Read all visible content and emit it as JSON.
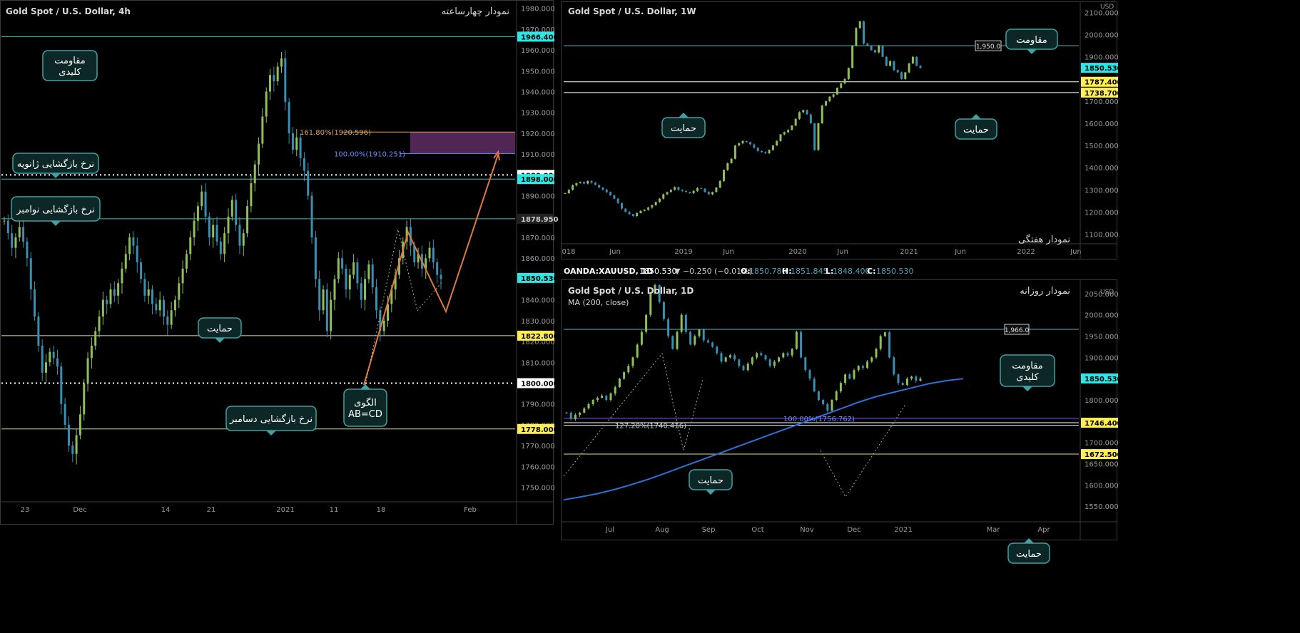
{
  "chart_data": [
    {
      "panel": "left",
      "type": "line",
      "title": "Gold Spot / U.S. Dollar, 4h",
      "subtitle": "نمودار چهارساعته",
      "x_ticks": [
        "23",
        "Dec",
        "14",
        "21",
        "2021",
        "11",
        "18",
        "Feb"
      ],
      "y_ticks": [
        "1750.000",
        "1760.000",
        "1770.000",
        "1780.000",
        "1790.000",
        "1800.000",
        "1810.000",
        "1820.000",
        "1830.000",
        "1840.000",
        "1850.000",
        "1860.000",
        "1870.000",
        "1880.000",
        "1890.000",
        "1900.000",
        "1910.000",
        "1920.000",
        "1930.000",
        "1940.000",
        "1950.000",
        "1960.000",
        "1970.000",
        "1980.000"
      ],
      "ylim": [
        1743,
        1984
      ],
      "price": [
        1878,
        1872,
        1865,
        1870,
        1875,
        1868,
        1860,
        1845,
        1832,
        1818,
        1805,
        1810,
        1815,
        1812,
        1808,
        1790,
        1780,
        1770,
        1766,
        1775,
        1785,
        1800,
        1812,
        1818,
        1825,
        1832,
        1840,
        1838,
        1845,
        1842,
        1848,
        1855,
        1862,
        1870,
        1866,
        1858,
        1850,
        1842,
        1845,
        1838,
        1835,
        1840,
        1832,
        1828,
        1835,
        1840,
        1848,
        1855,
        1862,
        1870,
        1878,
        1885,
        1892,
        1880,
        1870,
        1876,
        1868,
        1862,
        1872,
        1880,
        1888,
        1876,
        1866,
        1872,
        1885,
        1896,
        1905,
        1915,
        1928,
        1940,
        1948,
        1945,
        1952,
        1956,
        1935,
        1920,
        1912,
        1918,
        1908,
        1902,
        1890,
        1870,
        1850,
        1835,
        1845,
        1825,
        1840,
        1850,
        1860,
        1855,
        1845,
        1852,
        1858,
        1848,
        1840,
        1850,
        1857,
        1846,
        1835,
        1825,
        1830,
        1838,
        1845,
        1852,
        1860,
        1868,
        1875,
        1866,
        1858,
        1862,
        1855,
        1860,
        1865,
        1858,
        1852,
        1850
      ],
      "horizontal_levels": [
        {
          "value": 1966.4,
          "label": "1966.400",
          "line_color": "#4fb8c4",
          "box_color": "#2ee6e6",
          "text_color": "#000000"
        },
        {
          "value": 1900.0,
          "label": "1900.000",
          "line_color": "#ffffff",
          "dotted": true,
          "box_color": "#ffffff",
          "text_color": "#000000"
        },
        {
          "value": 1898.0,
          "label": "1898.000",
          "line_color": "#4fb8c4",
          "box_color": "#2ee6e6",
          "text_color": "#000000"
        },
        {
          "value": 1878.95,
          "label": "1878.950",
          "line_color": "#4fb8c4",
          "box_color": "#222222",
          "text_color": "#cccccc"
        },
        {
          "value": 1850.53,
          "label": "1850.530",
          "line_color": null,
          "box_color": "#2ee6e6",
          "text_color": "#000000"
        },
        {
          "value": 1822.8,
          "label": "1822.800",
          "line_color": "#dede9a",
          "box_color": "#ffee58",
          "text_color": "#000000"
        },
        {
          "value": 1800.0,
          "label": "1800.000",
          "line_color": "#ffffff",
          "dotted": true,
          "box_color": "#ffffff",
          "text_color": "#000000"
        },
        {
          "value": 1778.0,
          "label": "1778.000",
          "line_color": "#dede9a",
          "box_color": "#ffee58",
          "text_color": "#000000"
        }
      ],
      "fibonacci": [
        {
          "label": "161.80%(1920.596)",
          "value": 1920.596,
          "color": "#e0a060"
        },
        {
          "label": "100.00%(1910.251)",
          "value": 1910.251,
          "color": "#6c8cff"
        }
      ],
      "annotations": [
        {
          "id": "key-resistance",
          "text": [
            "مقاومت",
            "کلیدی"
          ]
        },
        {
          "id": "jan-open",
          "text": [
            "نرخ بازگشایی ژانویه"
          ]
        },
        {
          "id": "nov-open",
          "text": [
            "نرخ بازگشایی نوامبر"
          ]
        },
        {
          "id": "support",
          "text": [
            "حمایت"
          ]
        },
        {
          "id": "dec-open",
          "text": [
            "نرخ بازگشایی دسامبر"
          ]
        },
        {
          "id": "abcd",
          "text": [
            "الگوی",
            "AB=CD"
          ]
        }
      ]
    },
    {
      "panel": "top-right",
      "type": "line",
      "title": "Gold Spot / U.S. Dollar, 1W",
      "subtitle": "نمودار هفتگی",
      "currency_label": "USD",
      "x_ticks": [
        "018",
        "Jun",
        "2019",
        "Jun",
        "2020",
        "Jun",
        "2021",
        "Jun",
        "2022",
        "Jun"
      ],
      "y_ticks": [
        "1100.000",
        "1200.000",
        "1300.000",
        "1400.000",
        "1500.000",
        "1600.000",
        "1700.000",
        "1800.000",
        "1900.000",
        "2000.000",
        "2100.000"
      ],
      "ylim": [
        1050,
        2150
      ],
      "price": [
        1285,
        1300,
        1320,
        1330,
        1335,
        1328,
        1340,
        1332,
        1322,
        1310,
        1300,
        1290,
        1275,
        1260,
        1240,
        1215,
        1200,
        1190,
        1182,
        1195,
        1205,
        1210,
        1220,
        1230,
        1245,
        1260,
        1280,
        1290,
        1300,
        1312,
        1300,
        1295,
        1290,
        1285,
        1295,
        1308,
        1305,
        1290,
        1280,
        1290,
        1310,
        1340,
        1390,
        1420,
        1440,
        1500,
        1510,
        1520,
        1515,
        1505,
        1490,
        1475,
        1470,
        1465,
        1480,
        1500,
        1520,
        1550,
        1560,
        1570,
        1590,
        1620,
        1650,
        1660,
        1640,
        1600,
        1480,
        1600,
        1680,
        1700,
        1720,
        1730,
        1760,
        1780,
        1800,
        1850,
        1950,
        2030,
        2060,
        1960,
        1950,
        1930,
        1920,
        1950,
        1900,
        1860,
        1880,
        1840,
        1830,
        1800,
        1830,
        1870,
        1900,
        1860,
        1850
      ],
      "horizontal_levels": [
        {
          "value": 1950.0,
          "label": "1,950.0",
          "line_color": "#4fb8c4"
        },
        {
          "value": 1850.53,
          "label": "1850.530",
          "line_color": null,
          "box_color": "#2ee6e6",
          "text_color": "#000000"
        },
        {
          "value": 1787.4,
          "label": "1787.400",
          "line_color": "#ffffff",
          "box_color": "#ffee58",
          "text_color": "#000000"
        },
        {
          "value": 1738.7,
          "label": "1738.700",
          "line_color": "#ffffff",
          "box_color": "#ffee58",
          "text_color": "#000000"
        }
      ],
      "annotations": [
        {
          "id": "resistance",
          "text": [
            "مقاومت"
          ]
        },
        {
          "id": "support-left",
          "text": [
            "حمایت"
          ]
        },
        {
          "id": "support-right",
          "text": [
            "حمایت"
          ]
        }
      ]
    },
    {
      "panel": "bottom-right",
      "type": "line",
      "title": "Gold Spot / U.S. Dollar, 1D",
      "subtitle": "نمودار روزانه",
      "indicator_label": "MA (200, close)",
      "currency_label": "USD",
      "x_ticks": [
        "Jul",
        "Aug",
        "Sep",
        "Oct",
        "Nov",
        "Dec",
        "2021",
        "Mar",
        "Apr"
      ],
      "y_ticks": [
        "1550.000",
        "1600.000",
        "1650.000",
        "1700.000",
        "1750.000",
        "1800.000",
        "1850.000",
        "1900.000",
        "1950.000",
        "2000.000",
        "2050.000"
      ],
      "ylim": [
        1515,
        2080
      ],
      "price": [
        1770,
        1755,
        1765,
        1770,
        1780,
        1790,
        1800,
        1805,
        1810,
        1800,
        1815,
        1830,
        1850,
        1865,
        1880,
        1900,
        1930,
        1960,
        2000,
        2050,
        2070,
        2030,
        1990,
        1950,
        1920,
        1960,
        2000,
        1960,
        1930,
        1950,
        1965,
        1940,
        1935,
        1925,
        1910,
        1890,
        1900,
        1905,
        1895,
        1880,
        1870,
        1885,
        1900,
        1910,
        1905,
        1895,
        1880,
        1890,
        1900,
        1910,
        1905,
        1920,
        1960,
        1900,
        1870,
        1850,
        1820,
        1800,
        1790,
        1775,
        1800,
        1820,
        1840,
        1860,
        1850,
        1870,
        1880,
        1875,
        1890,
        1900,
        1920,
        1950,
        1959,
        1900,
        1860,
        1840,
        1835,
        1850,
        1855,
        1845,
        1850
      ],
      "ma200": [
        1565,
        1572,
        1580,
        1590,
        1602,
        1615,
        1630,
        1645,
        1660,
        1675,
        1690,
        1705,
        1720,
        1735,
        1750,
        1765,
        1780,
        1795,
        1808,
        1818,
        1828,
        1838,
        1845,
        1850
      ],
      "horizontal_levels": [
        {
          "value": 1966.0,
          "label": "1,966.0",
          "line_color": "#4fb8c4"
        },
        {
          "value": 1850.53,
          "label": "1850.530",
          "line_color": null,
          "box_color": "#2ee6e6",
          "text_color": "#000000"
        },
        {
          "value": 1756.762,
          "label": "",
          "line_color": "#8a55ff"
        },
        {
          "value": 1746.4,
          "label": "1746.400",
          "line_color": "#ffffff",
          "box_color": "#ffee58",
          "text_color": "#000000"
        },
        {
          "value": 1740.416,
          "label": "",
          "line_color": "#dddddd"
        },
        {
          "value": 1672.5,
          "label": "1672.500",
          "line_color": "#dede9a",
          "box_color": "#ffee58",
          "text_color": "#000000"
        }
      ],
      "fibonacci": [
        {
          "label": "100.00%(1756.762)",
          "value": 1756.762,
          "color": "#6c8cff"
        },
        {
          "label": "127.20%(1740.416)",
          "value": 1740.416,
          "color": "#cccccc"
        }
      ],
      "annotations": [
        {
          "id": "key-resistance",
          "text": [
            "مقاومت",
            "کلیدی"
          ]
        },
        {
          "id": "support-top",
          "text": [
            "حمایت"
          ]
        },
        {
          "id": "support-bottom",
          "text": [
            "حمایت"
          ]
        }
      ]
    }
  ],
  "symbol_bar": {
    "symbol": "OANDA:XAUUSD, 1D",
    "last": "1850.530",
    "change": "▼ −0.250 (−0.01%)",
    "o_label": "O:",
    "o_value": "1850.780",
    "h_label": "H:",
    "h_value": "1851.845",
    "l_label": "L:",
    "l_value": "1848.400",
    "c_label": "C:",
    "c_value": "1850.530"
  },
  "colors": {
    "candle_up": "#8fbf5a",
    "candle_down": "#3a8fb0",
    "abcd_line": "#e07a3c",
    "ma_line": "#2f6fd8",
    "callout_border": "#3fa1a1",
    "callout_fill": "#0d2727",
    "target_zone": "#5a2a5e"
  }
}
